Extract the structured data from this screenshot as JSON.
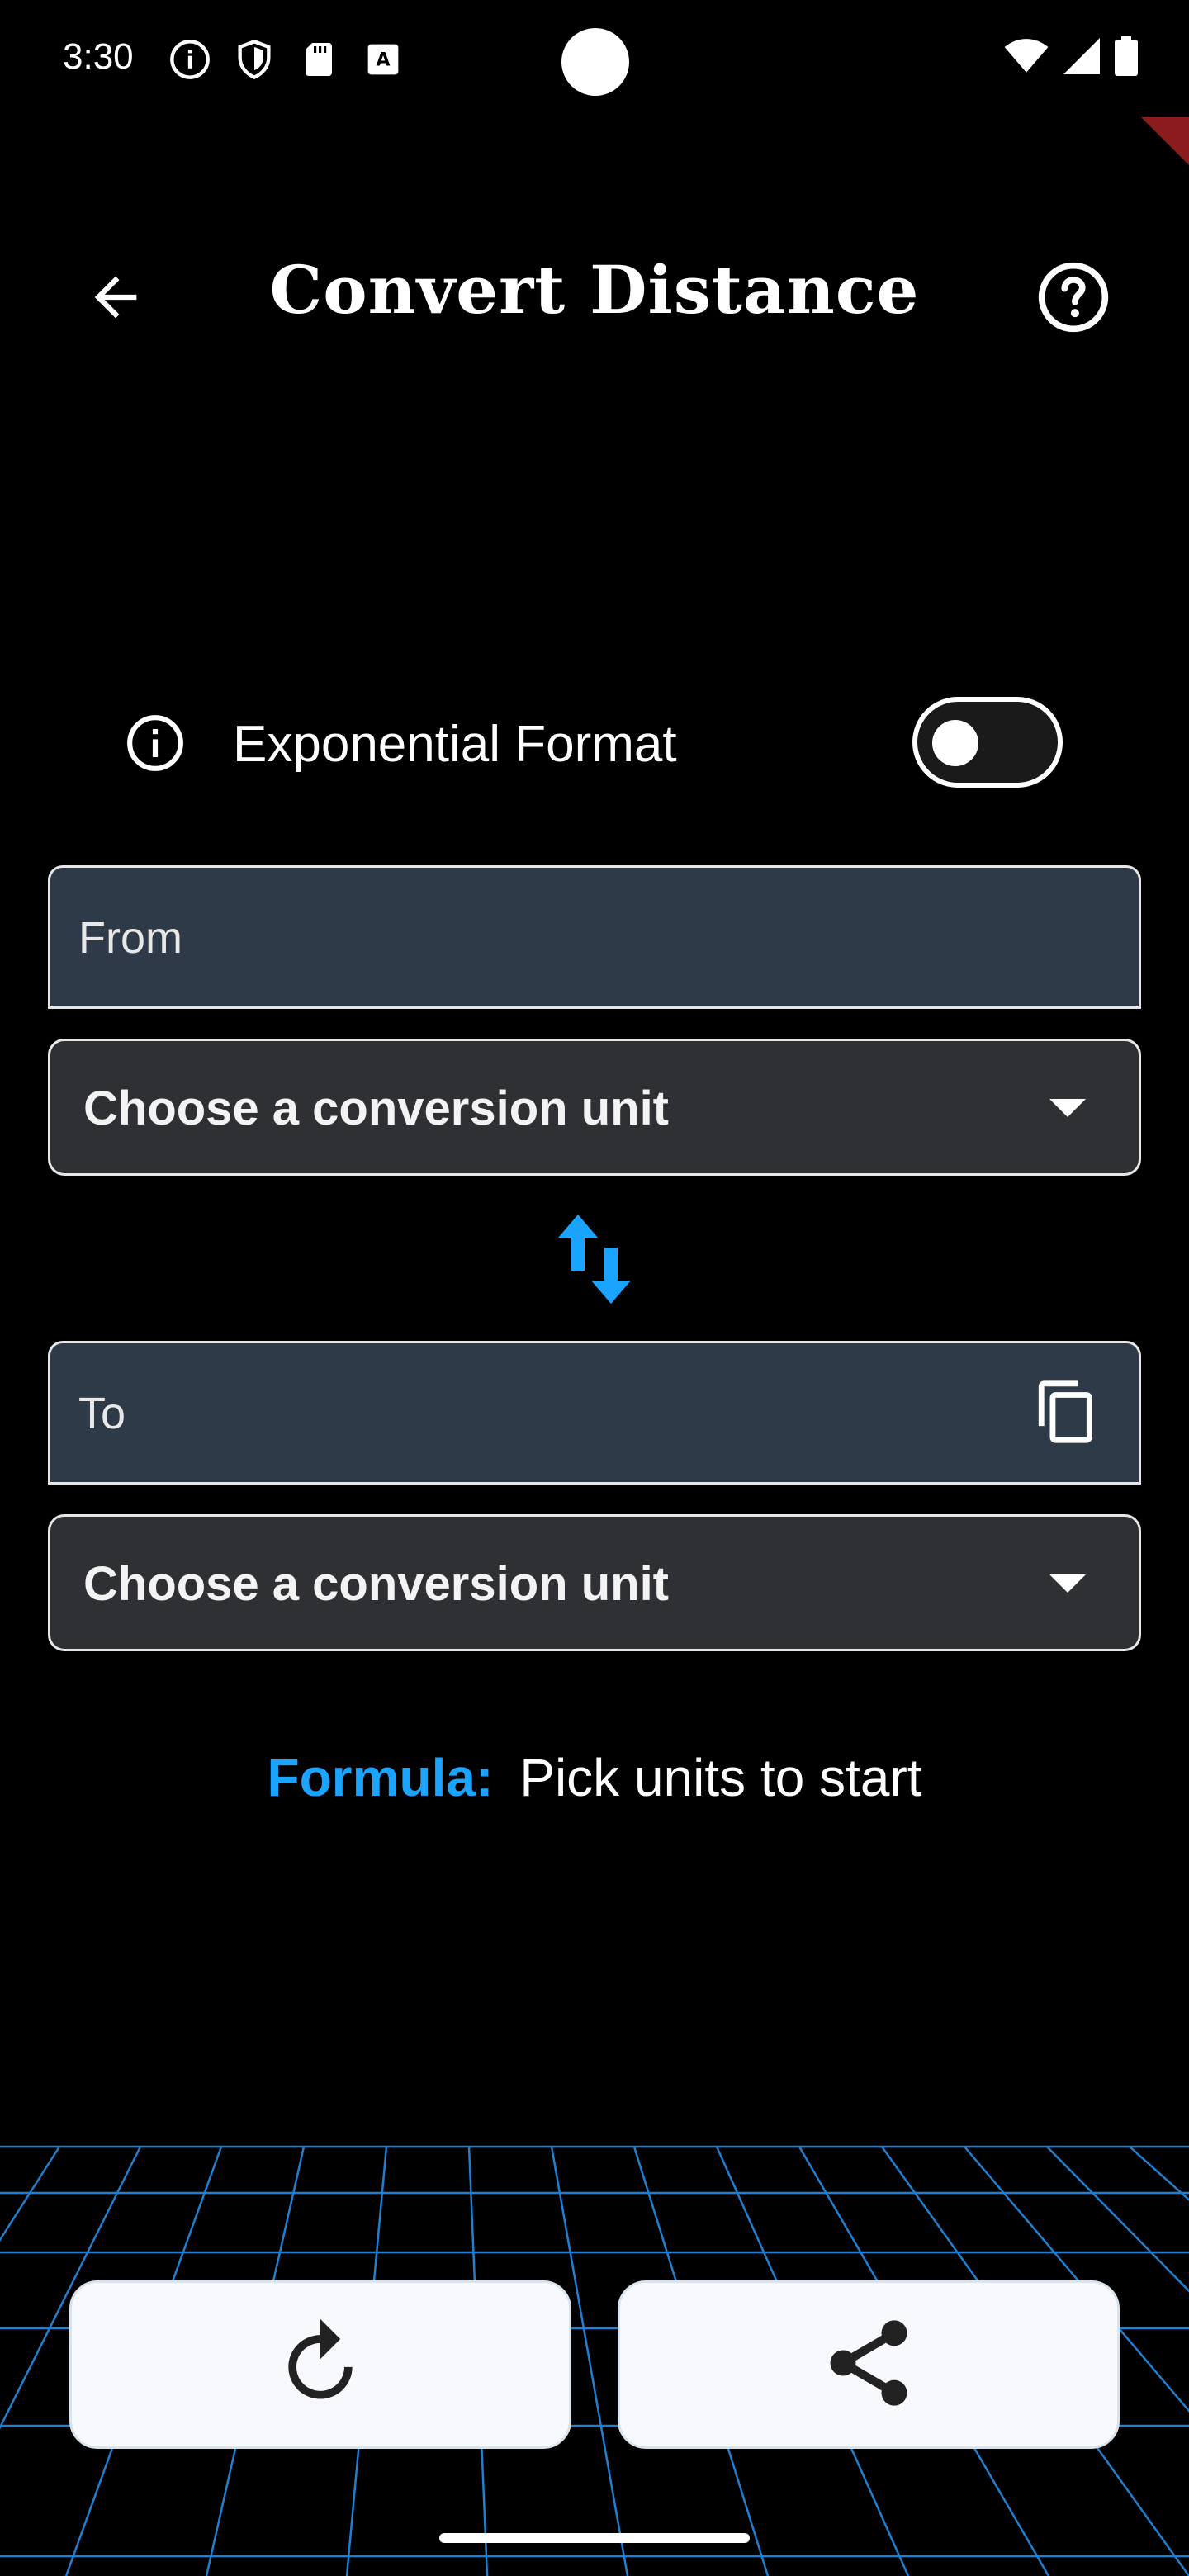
{
  "status_bar": {
    "time": "3:30",
    "left_icons": [
      "info-circle-icon",
      "shield-icon",
      "sd-card-icon",
      "font-download-icon"
    ],
    "right_icons": [
      "wifi-icon",
      "signal-icon",
      "battery-icon"
    ]
  },
  "app_bar": {
    "title": "Convert Distance",
    "back_icon": "arrow-left-icon",
    "help_icon": "help-circle-icon"
  },
  "exponential_format": {
    "label": "Exponential Format",
    "enabled": false
  },
  "from": {
    "placeholder": "From",
    "unit_placeholder": "Choose a conversion unit"
  },
  "to": {
    "placeholder": "To",
    "unit_placeholder": "Choose a conversion unit"
  },
  "formula": {
    "label": "Formula:",
    "text": "Pick units to start"
  },
  "actions": {
    "reset_icon": "refresh-icon",
    "share_icon": "share-icon"
  },
  "colors": {
    "accent": "#1aa3ff",
    "field_bg": "#2e3a47",
    "dropdown_bg": "#2f3033",
    "grid_line": "#1f7fd0",
    "corner_flag": "#8b1a1f"
  }
}
